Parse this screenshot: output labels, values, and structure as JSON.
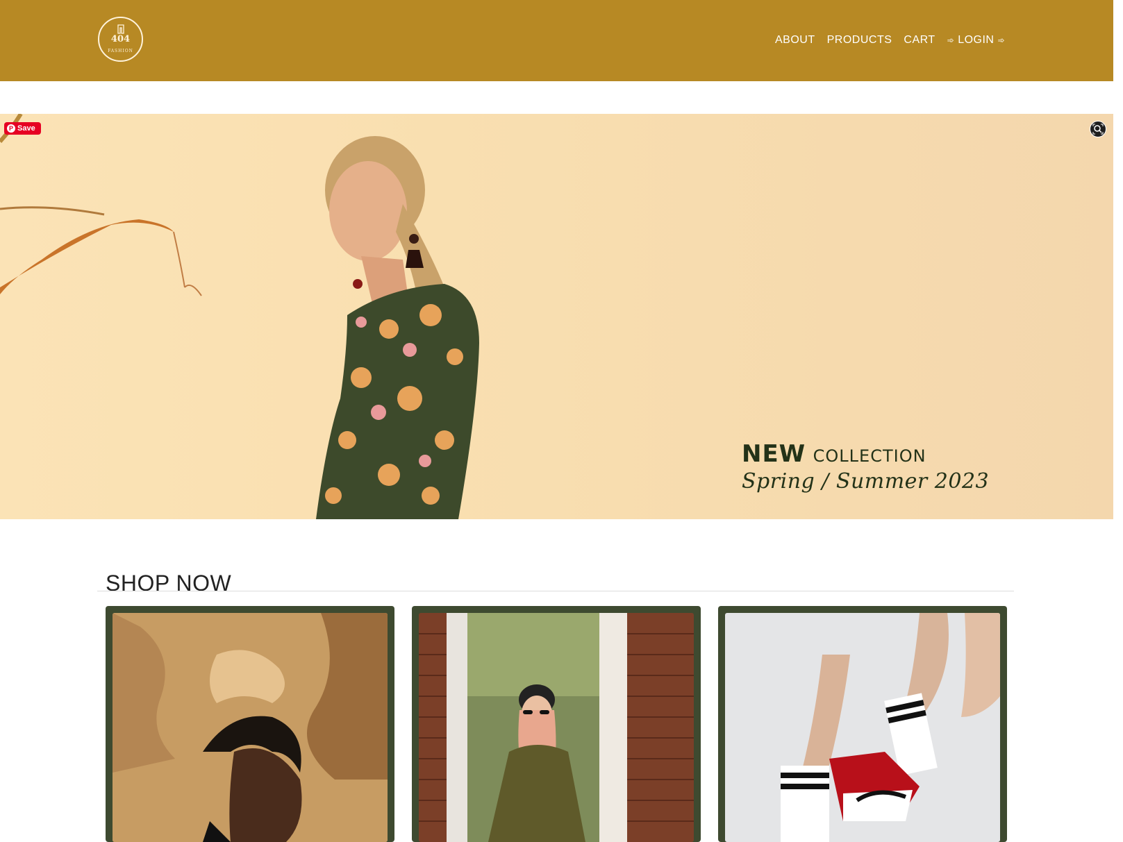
{
  "brand": {
    "logo_number": "404",
    "logo_word": "FASHION"
  },
  "nav": {
    "items": [
      "ABOUT",
      "PRODUCTS",
      "CART"
    ],
    "login": {
      "arrow_left": "➾",
      "label": "LOGIN",
      "arrow_right": "➾"
    }
  },
  "hero": {
    "save_button": "Save",
    "pinterest_glyph": "P",
    "new_label": "NEW",
    "collection_label": "COLLECTION",
    "season": "Spring / Summer 2023",
    "lens_icon": "visual-search-icon"
  },
  "shop": {
    "title": "SHOP NOW",
    "cards": [
      {
        "image": "man-with-dreadlocks-photo"
      },
      {
        "image": "woman-in-olive-dress-photo"
      },
      {
        "image": "sneakers-and-socks-photo"
      }
    ]
  },
  "colors": {
    "navbar": "#b78924",
    "card_frame": "#3e4a30",
    "hero_text": "#233218",
    "pinterest": "#e60023"
  }
}
